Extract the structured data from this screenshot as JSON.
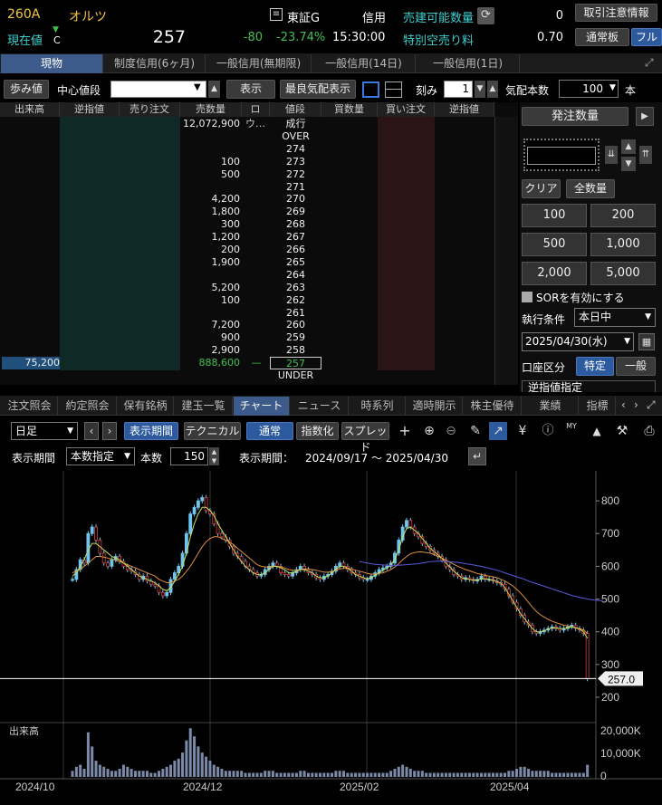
{
  "header": {
    "code": "260A",
    "name": "オルツ",
    "market": "東証G",
    "credit": "信用",
    "price_label": "現在値",
    "price_mark": "C",
    "price": "257",
    "change": "-80",
    "change_pct": "-23.74%",
    "time": "15:30:00",
    "sellable_label": "売建可能数量",
    "sellable_value": "0",
    "special_label": "特別空売り料",
    "special_value": "0.70",
    "btn_notice": "取引注意情報",
    "btn_normal": "通常板",
    "btn_full": "フル"
  },
  "tabs": [
    "現物",
    "制度信用(6ヶ月)",
    "一般信用(無期限)",
    "一般信用(14日)",
    "一般信用(1日)"
  ],
  "toolbar": {
    "walk": "歩み値",
    "center_label": "中心値段",
    "show": "表示",
    "best": "最良気配表示",
    "tick_label": "刻み",
    "tick_value": "1",
    "depth_label": "気配本数",
    "depth_value": "100",
    "depth_unit": "本"
  },
  "board": {
    "headers": [
      "出来高",
      "逆指値",
      "売り注文",
      "売数量",
      "ロウ…",
      "値段",
      "買数量",
      "買い注文",
      "逆指値"
    ],
    "rows": [
      {
        "sell": "12,072,900",
        "price": "成行",
        "vol": "",
        "buy": ""
      },
      {
        "sell": "",
        "price": "OVER",
        "vol": "",
        "buy": ""
      },
      {
        "sell": "",
        "price": "274",
        "vol": "",
        "buy": ""
      },
      {
        "sell": "100",
        "price": "273",
        "vol": "",
        "buy": ""
      },
      {
        "sell": "500",
        "price": "272",
        "vol": "",
        "buy": ""
      },
      {
        "sell": "",
        "price": "271",
        "vol": "",
        "buy": ""
      },
      {
        "sell": "4,200",
        "price": "270",
        "vol": "",
        "buy": ""
      },
      {
        "sell": "1,800",
        "price": "269",
        "vol": "",
        "buy": ""
      },
      {
        "sell": "300",
        "price": "268",
        "vol": "",
        "buy": ""
      },
      {
        "sell": "1,200",
        "price": "267",
        "vol": "",
        "buy": ""
      },
      {
        "sell": "200",
        "price": "266",
        "vol": "",
        "buy": ""
      },
      {
        "sell": "1,900",
        "price": "265",
        "vol": "",
        "buy": ""
      },
      {
        "sell": "",
        "price": "264",
        "vol": "",
        "buy": ""
      },
      {
        "sell": "5,200",
        "price": "263",
        "vol": "",
        "buy": ""
      },
      {
        "sell": "100",
        "price": "262",
        "vol": "",
        "buy": ""
      },
      {
        "sell": "",
        "price": "261",
        "vol": "",
        "buy": ""
      },
      {
        "sell": "7,200",
        "price": "260",
        "vol": "",
        "buy": ""
      },
      {
        "sell": "900",
        "price": "259",
        "vol": "",
        "buy": ""
      },
      {
        "sell": "2,900",
        "price": "258",
        "vol": "",
        "buy": ""
      },
      {
        "sell": "888,600",
        "price": "257",
        "vol": "75,200",
        "buy": "",
        "dash": "—"
      },
      {
        "sell": "",
        "price": "UNDER",
        "vol": "",
        "buy": ""
      }
    ]
  },
  "order": {
    "qty_btn": "発注数量",
    "clear": "クリア",
    "all": "全数量",
    "q": [
      "100",
      "200",
      "500",
      "1,000",
      "2,000",
      "5,000"
    ],
    "sor": "SORを有効にする",
    "exec_label": "執行条件",
    "exec_value": "本日中",
    "date": "2025/04/30(水)",
    "acct_label": "口座区分",
    "acct_a": "特定",
    "acct_b": "一般",
    "stop": "逆指値指定"
  },
  "bottom_tabs": [
    "注文照会",
    "約定照会",
    "保有銘柄",
    "建玉一覧",
    "チャート",
    "ニュース",
    "時系列",
    "適時開示",
    "株主優待",
    "業績",
    "指標"
  ],
  "chart_tools": {
    "period": "日足",
    "show_period": "表示期間",
    "technical": "テクニカル",
    "normal": "通常",
    "index": "指数化",
    "spread": "スプレッド",
    "yen": "¥",
    "my": "MY"
  },
  "chart_tools2": {
    "period_label": "表示期間",
    "period_value": "本数指定",
    "count_label": "本数",
    "count_value": "150",
    "range_label": "表示期間：",
    "range_value": "2024/09/17 ～ 2025/04/30"
  },
  "colors": {
    "up": "#6ec6f0",
    "down": "#6ec6f0",
    "ma_short": "#c8e05a",
    "ma_mid": "#e0903a",
    "ma_long": "#5a5ae0",
    "accent": "#3c5a8a"
  },
  "chart_data": {
    "type": "candlestick",
    "price_axis": [
      800,
      700,
      600,
      500,
      400,
      300,
      200
    ],
    "ylim": [
      200,
      850
    ],
    "current_price": "257.0",
    "x_ticks": [
      "2024/10",
      "2024/12",
      "2025/02",
      "2025/04"
    ],
    "volume_label": "出来高",
    "volume_axis": [
      "20,000K",
      "10,000K",
      "0"
    ],
    "close": [
      560,
      590,
      620,
      610,
      700,
      720,
      680,
      640,
      610,
      600,
      620,
      630,
      615,
      600,
      590,
      585,
      575,
      560,
      570,
      555,
      545,
      540,
      520,
      510,
      520,
      560,
      580,
      600,
      640,
      700,
      760,
      780,
      800,
      810,
      770,
      760,
      730,
      700,
      690,
      680,
      660,
      640,
      630,
      615,
      600,
      590,
      580,
      570,
      575,
      590,
      600,
      610,
      600,
      580,
      575,
      570,
      580,
      590,
      600,
      590,
      580,
      575,
      565,
      560,
      570,
      575,
      585,
      600,
      610,
      600,
      590,
      580,
      575,
      565,
      560,
      560,
      570,
      580,
      590,
      595,
      600,
      610,
      640,
      680,
      720,
      740,
      720,
      700,
      690,
      670,
      660,
      650,
      640,
      630,
      620,
      600,
      590,
      575,
      570,
      560,
      565,
      560,
      555,
      560,
      570,
      560,
      560,
      555,
      550,
      545,
      530,
      510,
      490,
      470,
      450,
      430,
      420,
      400,
      395,
      400,
      405,
      410,
      415,
      410,
      405,
      410,
      415,
      420,
      410,
      405,
      395,
      257
    ],
    "ma_short": [
      570,
      580,
      600,
      620,
      650,
      670,
      670,
      660,
      650,
      640,
      630,
      625,
      620,
      610,
      600,
      590,
      580,
      570,
      565,
      560,
      555,
      550,
      540,
      530,
      525,
      535,
      555,
      575,
      600,
      640,
      690,
      730,
      760,
      780,
      780,
      770,
      755,
      730,
      710,
      690,
      670,
      650,
      630,
      615,
      600,
      590,
      580,
      575,
      575,
      580,
      590,
      600,
      600,
      595,
      590,
      580,
      580,
      585,
      590,
      590,
      585,
      580,
      570,
      565,
      565,
      570,
      580,
      590,
      600,
      600,
      595,
      585,
      575,
      570,
      565,
      562,
      565,
      572,
      580,
      588,
      595,
      605,
      620,
      650,
      690,
      715,
      720,
      710,
      700,
      685,
      670,
      655,
      645,
      635,
      625,
      610,
      598,
      585,
      575,
      565,
      562,
      560,
      558,
      558,
      562,
      562,
      560,
      557,
      553,
      548,
      535,
      515,
      495,
      475,
      455,
      440,
      425,
      410,
      400,
      400,
      403,
      408,
      412,
      412,
      410,
      410,
      412,
      415,
      413,
      408,
      400,
      380
    ],
    "ma_mid": [
      580,
      585,
      590,
      600,
      610,
      620,
      630,
      630,
      628,
      625,
      622,
      618,
      615,
      610,
      605,
      600,
      595,
      590,
      585,
      580,
      575,
      570,
      560,
      555,
      550,
      550,
      555,
      560,
      570,
      585,
      600,
      620,
      640,
      660,
      675,
      685,
      690,
      690,
      685,
      680,
      675,
      665,
      655,
      645,
      635,
      625,
      615,
      605,
      600,
      598,
      598,
      600,
      600,
      598,
      595,
      590,
      588,
      588,
      590,
      592,
      592,
      590,
      588,
      585,
      582,
      582,
      584,
      588,
      592,
      594,
      594,
      592,
      588,
      585,
      582,
      578,
      576,
      576,
      578,
      580,
      585,
      590,
      598,
      608,
      620,
      630,
      638,
      642,
      644,
      644,
      642,
      640,
      636,
      630,
      625,
      618,
      612,
      606,
      600,
      595,
      590,
      586,
      582,
      578,
      575,
      572,
      570,
      568,
      565,
      560,
      555,
      548,
      540,
      530,
      518,
      505,
      490,
      475,
      462,
      452,
      445,
      438,
      432,
      428,
      424,
      420,
      418,
      415,
      412,
      410,
      405,
      395
    ],
    "ma_long_start": 73,
    "ma_long": [
      615,
      612,
      610,
      608,
      606,
      605,
      604,
      603,
      603,
      603,
      603,
      604,
      605,
      606,
      607,
      608,
      610,
      612,
      614,
      615,
      616,
      616,
      615,
      614,
      613,
      612,
      610,
      608,
      606,
      604,
      602,
      600,
      597,
      594,
      591,
      588,
      584,
      580,
      576,
      572,
      568,
      564,
      560,
      555,
      551,
      547,
      543,
      539,
      535,
      531,
      527,
      523,
      519,
      515,
      511,
      508,
      505,
      503,
      500,
      498,
      497,
      495,
      493
    ],
    "volume": [
      3,
      5,
      6,
      4,
      22,
      15,
      8,
      6,
      5,
      4,
      3,
      3,
      4,
      6,
      5,
      4,
      3,
      3,
      3,
      3,
      2,
      2,
      3,
      4,
      5,
      6,
      8,
      9,
      12,
      18,
      24,
      20,
      15,
      12,
      10,
      8,
      6,
      5,
      4,
      3,
      3,
      3,
      3,
      3,
      2,
      2,
      2,
      2,
      2,
      3,
      3,
      3,
      2,
      2,
      2,
      2,
      2,
      2,
      3,
      3,
      2,
      2,
      2,
      2,
      2,
      2,
      2,
      3,
      3,
      3,
      2,
      2,
      2,
      2,
      2,
      2,
      2,
      2,
      2,
      2,
      2,
      3,
      4,
      5,
      6,
      5,
      4,
      3,
      3,
      3,
      2,
      2,
      2,
      2,
      2,
      2,
      2,
      2,
      2,
      2,
      2,
      2,
      2,
      2,
      2,
      2,
      2,
      2,
      2,
      2,
      2,
      3,
      3,
      4,
      5,
      5,
      4,
      3,
      3,
      3,
      3,
      3,
      2,
      2,
      2,
      2,
      2,
      2,
      2,
      2,
      2,
      6
    ]
  }
}
